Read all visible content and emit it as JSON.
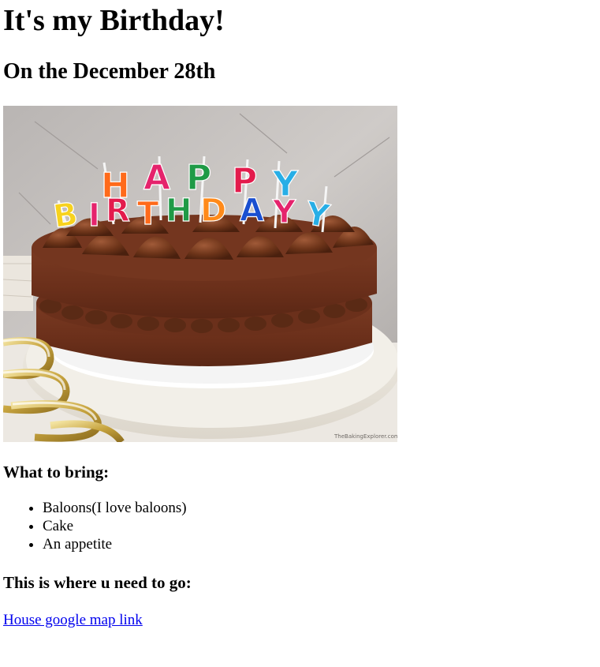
{
  "page": {
    "title": "It's my Birthday!",
    "subtitle": "On the December 28th"
  },
  "image": {
    "alt": "Chocolate birthday cake with HAPPY BIRTHDAY candles",
    "candle_text_top": "HAPPY",
    "candle_text_bottom": "BIRTHDAY",
    "watermark": "TheBakingExplorer.com"
  },
  "bring": {
    "heading": "What to bring:",
    "items": [
      "Baloons(I love baloons)",
      "Cake",
      "An appetite"
    ]
  },
  "directions": {
    "heading": "This is where u need to go:",
    "link_text": "House google map link"
  },
  "colors": {
    "link": "#0000ee",
    "candle_colors": [
      "#f7d21e",
      "#e5236c",
      "#ff6a1a",
      "#1f9a46",
      "#1a4fd0",
      "#27aee6",
      "#e31b4c"
    ]
  }
}
